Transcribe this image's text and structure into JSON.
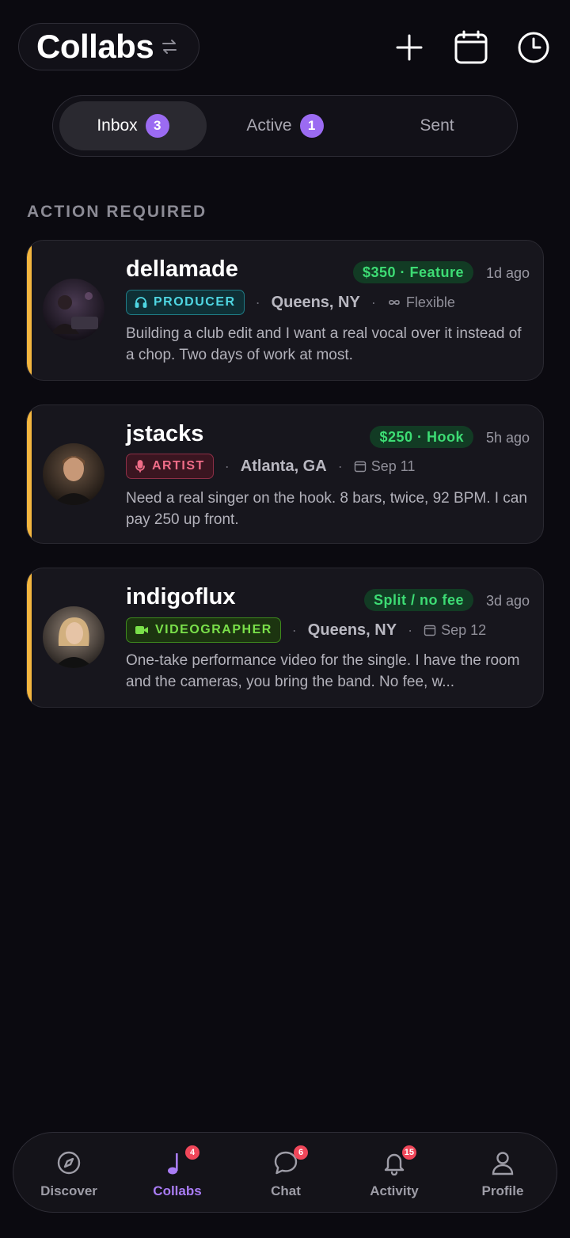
{
  "header": {
    "title": "Collabs",
    "swap_icon": "swap-icon",
    "add_icon": "plus-icon",
    "calendar_icon": "calendar-icon",
    "history_icon": "clock-icon"
  },
  "tabs": [
    {
      "label": "Inbox",
      "count": "3",
      "active": true
    },
    {
      "label": "Active",
      "count": "1",
      "active": false
    },
    {
      "label": "Sent",
      "count": "",
      "active": false
    }
  ],
  "section": {
    "title": "ACTION REQUIRED"
  },
  "accent_color": "#f4b63f",
  "requests": [
    {
      "username": "dellamade",
      "fee": "$350 · Feature",
      "time_ago": "1d ago",
      "role": "PRODUCER",
      "role_icon": "headphones-icon",
      "location": "Queens, NY",
      "timing_icon": "infinity-icon",
      "timing": "Flexible",
      "message": "Building a club edit and I want a real vocal over it instead of a chop. Two days of work at most."
    },
    {
      "username": "jstacks",
      "fee": "$250 · Hook",
      "time_ago": "5h ago",
      "role": "ARTIST",
      "role_icon": "microphone-icon",
      "location": "Atlanta, GA",
      "timing_icon": "calendar-icon",
      "timing": "Sep 11",
      "message": "Need a real singer on the hook. 8 bars, twice, 92 BPM. I can pay 250 up front."
    },
    {
      "username": "indigoflux",
      "fee": "Split / no fee",
      "time_ago": "3d ago",
      "role": "VIDEOGRAPHER",
      "role_icon": "video-camera-icon",
      "location": "Queens, NY",
      "timing_icon": "calendar-icon",
      "timing": "Sep 12",
      "message": "One-take performance video for the single. I have the room and the cameras, you bring the band. No fee, w..."
    }
  ],
  "bottom_nav": [
    {
      "label": "Discover",
      "icon": "compass-icon",
      "badge": "",
      "active": false
    },
    {
      "label": "Collabs",
      "icon": "music-note-icon",
      "badge": "4",
      "active": true
    },
    {
      "label": "Chat",
      "icon": "chat-bubble-icon",
      "badge": "6",
      "active": false
    },
    {
      "label": "Activity",
      "icon": "bell-icon",
      "badge": "15",
      "active": false
    },
    {
      "label": "Profile",
      "icon": "user-icon",
      "badge": "",
      "active": false
    }
  ]
}
